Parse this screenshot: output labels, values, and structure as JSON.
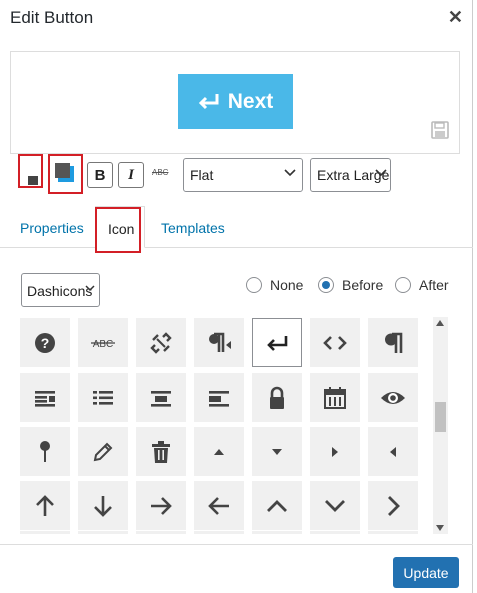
{
  "dialog": {
    "title": "Edit Button"
  },
  "preview": {
    "button_label": "Next",
    "button_color": "#4ab8e8"
  },
  "toolbar": {
    "bold_label": "B",
    "italic_label": "I",
    "strike_label": "ABC",
    "style_value": "Flat",
    "size_value": "Extra Large"
  },
  "tabs": [
    {
      "label": "Properties"
    },
    {
      "label": "Icon",
      "active": true
    },
    {
      "label": "Templates"
    }
  ],
  "icon_panel": {
    "iconset_value": "Dashicons",
    "position_options": [
      {
        "label": "None",
        "selected": false
      },
      {
        "label": "Before",
        "selected": true
      },
      {
        "label": "After",
        "selected": false
      }
    ],
    "icons": [
      [
        "editor-help-icon",
        "editor-strikethrough-icon",
        "editor-unlink-icon",
        "editor-ltr-icon",
        "editor-break-icon",
        "editor-code-icon",
        "editor-paragraph-icon"
      ],
      [
        "editor-table-icon",
        "editor-textcolor-icon",
        "align-center-icon",
        "align-left-icon",
        "lock-icon",
        "calendar-icon",
        "visibility-icon"
      ],
      [
        "pushpin-icon",
        "edit-icon",
        "trash-icon",
        "arrow-up-icon",
        "arrow-down-icon",
        "arrow-right-icon",
        "arrow-left-icon"
      ],
      [
        "arrow-up-alt-icon",
        "arrow-down-alt-icon",
        "arrow-right-alt-icon",
        "arrow-left-alt-icon",
        "arrow-up-alt2-icon",
        "arrow-down-alt2-icon",
        "arrow-right-alt2-icon"
      ]
    ],
    "selected_icon": "editor-break-icon"
  },
  "footer": {
    "update_label": "Update"
  },
  "colors": {
    "accent": "#2271b1",
    "highlight": "#d31f26",
    "link": "#0073aa"
  }
}
